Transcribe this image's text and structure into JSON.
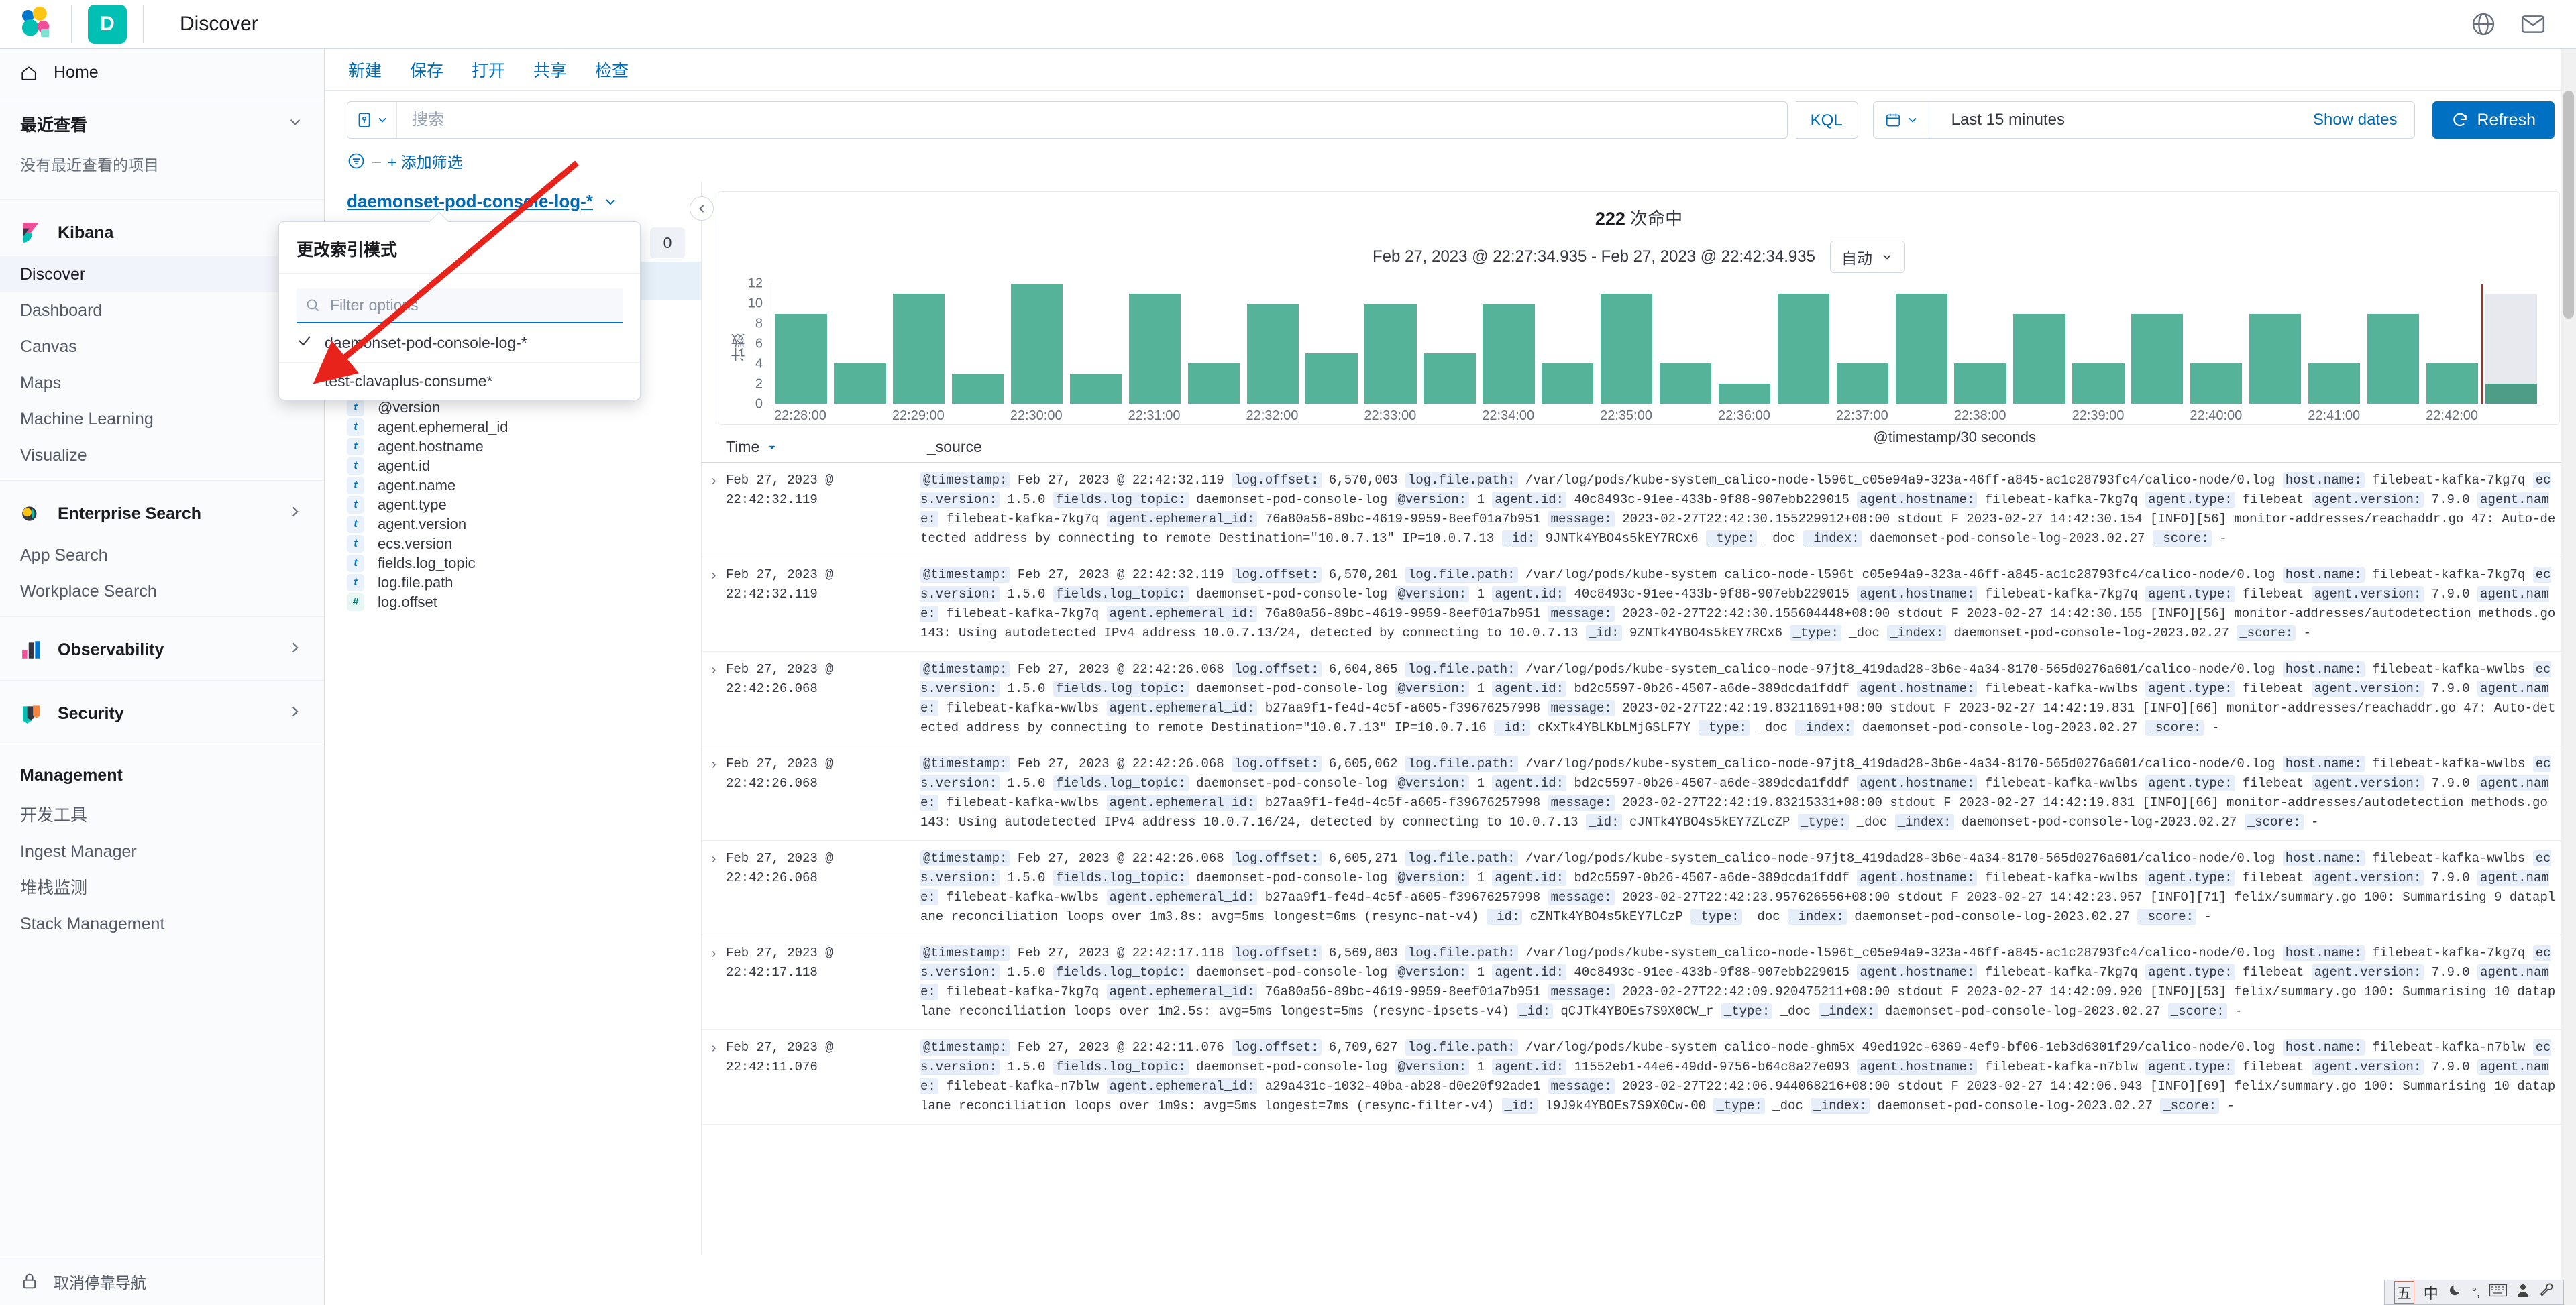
{
  "header": {
    "app_badge": "D",
    "app_title": "Discover",
    "icons": [
      "globe-icon",
      "mail-icon"
    ]
  },
  "sidebar": {
    "home_label": "Home",
    "recent": {
      "title": "最近查看",
      "empty": "没有最近查看的项目"
    },
    "groups": [
      {
        "name": "Kibana",
        "items": [
          "Discover",
          "Dashboard",
          "Canvas",
          "Maps",
          "Machine Learning",
          "Visualize"
        ]
      },
      {
        "name": "Enterprise Search",
        "items": [
          "App Search",
          "Workplace Search"
        ]
      },
      {
        "name": "Observability",
        "items": []
      },
      {
        "name": "Security",
        "items": []
      },
      {
        "name": "Management",
        "items": [
          "开发工具",
          "Ingest Manager",
          "堆栈监测",
          "Stack Management"
        ]
      }
    ],
    "active_item": "Discover",
    "dock_label": "取消停靠导航"
  },
  "menu_bar": [
    "新建",
    "保存",
    "打开",
    "共享",
    "检查"
  ],
  "search": {
    "placeholder": "搜索",
    "value": "",
    "language": "KQL"
  },
  "filters": {
    "add_label": "+ 添加筛选"
  },
  "time": {
    "value": "Last 15 minutes",
    "show_dates": "Show dates",
    "refresh": "Refresh"
  },
  "index_pattern": {
    "selected": "daemonset-pod-console-log-*",
    "popover": {
      "title": "更改索引模式",
      "filter_placeholder": "Filter options",
      "options": [
        "daemonset-pod-console-log-*",
        "test-clavaplus-consume*"
      ],
      "checked_index": 0
    }
  },
  "field_panel": {
    "search_placeholder": "",
    "count": "0",
    "selected_label": "",
    "fields": [
      {
        "name": "host.name",
        "type": "t",
        "selected": true
      },
      {
        "name": "message",
        "type": "t",
        "selected": true
      },
      {
        "name": "_id",
        "type": "t",
        "selected": false
      },
      {
        "name": "_index",
        "type": "t",
        "selected": false
      },
      {
        "name": "_score",
        "type": "num",
        "selected": false
      },
      {
        "name": "_type",
        "type": "t",
        "selected": false
      },
      {
        "name": "@timestamp",
        "type": "date",
        "selected": false
      },
      {
        "name": "@version",
        "type": "t",
        "selected": false
      },
      {
        "name": "agent.ephemeral_id",
        "type": "t",
        "selected": false
      },
      {
        "name": "agent.hostname",
        "type": "t",
        "selected": false
      },
      {
        "name": "agent.id",
        "type": "t",
        "selected": false
      },
      {
        "name": "agent.name",
        "type": "t",
        "selected": false
      },
      {
        "name": "agent.type",
        "type": "t",
        "selected": false
      },
      {
        "name": "agent.version",
        "type": "t",
        "selected": false
      },
      {
        "name": "ecs.version",
        "type": "t",
        "selected": false
      },
      {
        "name": "fields.log_topic",
        "type": "t",
        "selected": false
      },
      {
        "name": "log.file.path",
        "type": "t",
        "selected": false
      },
      {
        "name": "log.offset",
        "type": "num",
        "selected": false
      }
    ]
  },
  "chart_header": {
    "hits_number": "222",
    "hits_suffix": " 次命中",
    "range": "Feb 27, 2023 @ 22:27:34.935 - Feb 27, 2023 @ 22:42:34.935",
    "interval": "自动"
  },
  "chart_data": {
    "type": "bar",
    "title": "",
    "xlabel": "@timestamp/30 seconds",
    "ylabel": "计数",
    "ylim": [
      0,
      12
    ],
    "yticks": [
      0,
      2,
      4,
      6,
      8,
      10,
      12
    ],
    "grid": false,
    "legend": "none",
    "bar_color": "#54B399",
    "partial_bar_color": "#4e9e87",
    "partial_bg_color": "#e7e9ee",
    "categories": [
      "22:28:00",
      "22:28:30",
      "22:29:00",
      "22:29:30",
      "22:30:00",
      "22:30:30",
      "22:31:00",
      "22:31:30",
      "22:32:00",
      "22:32:30",
      "22:33:00",
      "22:33:30",
      "22:34:00",
      "22:34:30",
      "22:35:00",
      "22:35:30",
      "22:36:00",
      "22:36:30",
      "22:37:00",
      "22:37:30",
      "22:38:00",
      "22:38:30",
      "22:39:00",
      "22:39:30",
      "22:40:00",
      "22:40:30",
      "22:41:00",
      "22:41:30",
      "22:42:00",
      "22:42:30"
    ],
    "values": [
      9,
      4,
      11,
      3,
      12,
      3,
      11,
      4,
      10,
      5,
      10,
      5,
      10,
      4,
      11,
      4,
      2,
      11,
      4,
      11,
      4,
      9,
      4,
      9,
      4,
      9,
      4,
      9,
      4,
      11
    ],
    "partial_last": true,
    "partial_value": 2,
    "xticks": [
      "22:28:00",
      "22:29:00",
      "22:30:00",
      "22:31:00",
      "22:32:00",
      "22:33:00",
      "22:34:00",
      "22:35:00",
      "22:36:00",
      "22:37:00",
      "22:38:00",
      "22:39:00",
      "22:40:00",
      "22:41:00",
      "22:42:00"
    ]
  },
  "docs_table": {
    "columns": [
      "Time",
      "_source"
    ],
    "sort": "desc",
    "rows": [
      {
        "time": "Feb 27, 2023 @ 22:42:32.119",
        "timestamp": "Feb 27, 2023 @ 22:42:32.119",
        "log_offset": "6,570,003",
        "log_file_path": "/var/log/pods/kube-system_calico-node-l596t_c05e94a9-323a-46ff-a845-ac1c28793fc4/calico-node/0.log",
        "host_name": "filebeat-kafka-7kg7q",
        "ecs_version": "1.5.0",
        "fields_log_topic": "daemonset-pod-console-log",
        "version": "1",
        "agent_id": "40c8493c-91ee-433b-9f88-907ebb229015",
        "agent_hostname": "filebeat-kafka-7kg7q",
        "agent_type": "filebeat",
        "agent_version": "7.9.0",
        "agent_name": "filebeat-kafka-7kg7q",
        "agent_ephemeral_id": "76a80a56-89bc-4619-9959-8eef01a7b951",
        "message": "2023-02-27T22:42:30.155229912+08:00 stdout F 2023-02-27 14:42:30.154 [INFO][56] monitor-addresses/reachaddr.go 47: Auto-detected address by connecting to remote Destination=\"10.0.7.13\" IP=10.0.7.13",
        "id": "9JNTk4YBO4s5kEY7RCx6",
        "type": "_doc",
        "index": "daemonset-pod-console-log-2023.02.27",
        "score": "-"
      },
      {
        "time": "Feb 27, 2023 @ 22:42:32.119",
        "timestamp": "Feb 27, 2023 @ 22:42:32.119",
        "log_offset": "6,570,201",
        "log_file_path": "/var/log/pods/kube-system_calico-node-l596t_c05e94a9-323a-46ff-a845-ac1c28793fc4/calico-node/0.log",
        "host_name": "filebeat-kafka-7kg7q",
        "ecs_version": "1.5.0",
        "fields_log_topic": "daemonset-pod-console-log",
        "version": "1",
        "agent_id": "40c8493c-91ee-433b-9f88-907ebb229015",
        "agent_hostname": "filebeat-kafka-7kg7q",
        "agent_type": "filebeat",
        "agent_version": "7.9.0",
        "agent_name": "filebeat-kafka-7kg7q",
        "agent_ephemeral_id": "76a80a56-89bc-4619-9959-8eef01a7b951",
        "message": "2023-02-27T22:42:30.155604448+08:00 stdout F 2023-02-27 14:42:30.155 [INFO][56] monitor-addresses/autodetection_methods.go 143: Using autodetected IPv4 address 10.0.7.13/24, detected by connecting to 10.0.7.13",
        "id": "9ZNTk4YBO4s5kEY7RCx6",
        "type": "_doc",
        "index": "daemonset-pod-console-log-2023.02.27",
        "score": "-"
      },
      {
        "time": "Feb 27, 2023 @ 22:42:26.068",
        "timestamp": "Feb 27, 2023 @ 22:42:26.068",
        "log_offset": "6,604,865",
        "log_file_path": "/var/log/pods/kube-system_calico-node-97jt8_419dad28-3b6e-4a34-8170-565d0276a601/calico-node/0.log",
        "host_name": "filebeat-kafka-wwlbs",
        "ecs_version": "1.5.0",
        "fields_log_topic": "daemonset-pod-console-log",
        "version": "1",
        "agent_id": "bd2c5597-0b26-4507-a6de-389dcda1fddf",
        "agent_hostname": "filebeat-kafka-wwlbs",
        "agent_type": "filebeat",
        "agent_version": "7.9.0",
        "agent_name": "filebeat-kafka-wwlbs",
        "agent_ephemeral_id": "b27aa9f1-fe4d-4c5f-a605-f39676257998",
        "message": "2023-02-27T22:42:19.83211691+08:00 stdout F 2023-02-27 14:42:19.831 [INFO][66] monitor-addresses/reachaddr.go 47: Auto-detected address by connecting to remote Destination=\"10.0.7.13\" IP=10.0.7.16",
        "id": "cKxTk4YBLKbLMjGSLF7Y",
        "type": "_doc",
        "index": "daemonset-pod-console-log-2023.02.27",
        "score": "-"
      },
      {
        "time": "Feb 27, 2023 @ 22:42:26.068",
        "timestamp": "Feb 27, 2023 @ 22:42:26.068",
        "log_offset": "6,605,062",
        "log_file_path": "/var/log/pods/kube-system_calico-node-97jt8_419dad28-3b6e-4a34-8170-565d0276a601/calico-node/0.log",
        "host_name": "filebeat-kafka-wwlbs",
        "ecs_version": "1.5.0",
        "fields_log_topic": "daemonset-pod-console-log",
        "version": "1",
        "agent_id": "bd2c5597-0b26-4507-a6de-389dcda1fddf",
        "agent_hostname": "filebeat-kafka-wwlbs",
        "agent_type": "filebeat",
        "agent_version": "7.9.0",
        "agent_name": "filebeat-kafka-wwlbs",
        "agent_ephemeral_id": "b27aa9f1-fe4d-4c5f-a605-f39676257998",
        "message": "2023-02-27T22:42:19.83215331+08:00 stdout F 2023-02-27 14:42:19.831 [INFO][66] monitor-addresses/autodetection_methods.go 143: Using autodetected IPv4 address 10.0.7.16/24, detected by connecting to 10.0.7.13",
        "id": "cJNTk4YBO4s5kEY7ZLcZP",
        "type": "_doc",
        "index": "daemonset-pod-console-log-2023.02.27",
        "score": "-"
      },
      {
        "time": "Feb 27, 2023 @ 22:42:26.068",
        "timestamp": "Feb 27, 2023 @ 22:42:26.068",
        "log_offset": "6,605,271",
        "log_file_path": "/var/log/pods/kube-system_calico-node-97jt8_419dad28-3b6e-4a34-8170-565d0276a601/calico-node/0.log",
        "host_name": "filebeat-kafka-wwlbs",
        "ecs_version": "1.5.0",
        "fields_log_topic": "daemonset-pod-console-log",
        "version": "1",
        "agent_id": "bd2c5597-0b26-4507-a6de-389dcda1fddf",
        "agent_hostname": "filebeat-kafka-wwlbs",
        "agent_type": "filebeat",
        "agent_version": "7.9.0",
        "agent_name": "filebeat-kafka-wwlbs",
        "agent_ephemeral_id": "b27aa9f1-fe4d-4c5f-a605-f39676257998",
        "message": "2023-02-27T22:42:23.957626556+08:00 stdout F 2023-02-27 14:42:23.957 [INFO][71] felix/summary.go 100: Summarising 9 dataplane reconciliation loops over 1m3.8s: avg=5ms longest=6ms (resync-nat-v4)",
        "id": "cZNTk4YBO4s5kEY7LCzP",
        "type": "_doc",
        "index": "daemonset-pod-console-log-2023.02.27",
        "score": "-"
      },
      {
        "time": "Feb 27, 2023 @ 22:42:17.118",
        "timestamp": "Feb 27, 2023 @ 22:42:17.118",
        "log_offset": "6,569,803",
        "log_file_path": "/var/log/pods/kube-system_calico-node-l596t_c05e94a9-323a-46ff-a845-ac1c28793fc4/calico-node/0.log",
        "host_name": "filebeat-kafka-7kg7q",
        "ecs_version": "1.5.0",
        "fields_log_topic": "daemonset-pod-console-log",
        "version": "1",
        "agent_id": "40c8493c-91ee-433b-9f88-907ebb229015",
        "agent_hostname": "filebeat-kafka-7kg7q",
        "agent_type": "filebeat",
        "agent_version": "7.9.0",
        "agent_name": "filebeat-kafka-7kg7q",
        "agent_ephemeral_id": "76a80a56-89bc-4619-9959-8eef01a7b951",
        "message": "2023-02-27T22:42:09.920475211+08:00 stdout F 2023-02-27 14:42:09.920 [INFO][53] felix/summary.go 100: Summarising 10 dataplane reconciliation loops over 1m2.5s: avg=5ms longest=5ms (resync-ipsets-v4)",
        "id": "qCJTk4YBOEs7S9X0CW_r",
        "type": "_doc",
        "index": "daemonset-pod-console-log-2023.02.27",
        "score": "-"
      },
      {
        "time": "Feb 27, 2023 @ 22:42:11.076",
        "timestamp": "Feb 27, 2023 @ 22:42:11.076",
        "log_offset": "6,709,627",
        "log_file_path": "/var/log/pods/kube-system_calico-node-ghm5x_49ed192c-6369-4ef9-bf06-1eb3d6301f29/calico-node/0.log",
        "host_name": "filebeat-kafka-n7blw",
        "ecs_version": "1.5.0",
        "fields_log_topic": "daemonset-pod-console-log",
        "version": "1",
        "agent_id": "11552eb1-44e6-49dd-9756-b64c8a27e093",
        "agent_hostname": "filebeat-kafka-n7blw",
        "agent_type": "filebeat",
        "agent_version": "7.9.0",
        "agent_name": "filebeat-kafka-n7blw",
        "agent_ephemeral_id": "a29a431c-1032-40ba-ab28-d0e20f92ade1",
        "message": "2023-02-27T22:42:06.944068216+08:00 stdout F 2023-02-27 14:42:06.943 [INFO][69] felix/summary.go 100: Summarising 10 dataplane reconciliation loops over 1m9s: avg=5ms longest=7ms (resync-filter-v4)",
        "id": "l9J9k4YBOEs7S9X0Cw-00",
        "type": "_doc",
        "index": "daemonset-pod-console-log-2023.02.27",
        "score": "-"
      }
    ]
  },
  "ime_bar": {
    "items": [
      "五",
      "中",
      "moon-icon",
      "punctuation-icon",
      "keyboard-icon",
      "person-icon",
      "wrench-icon"
    ]
  }
}
